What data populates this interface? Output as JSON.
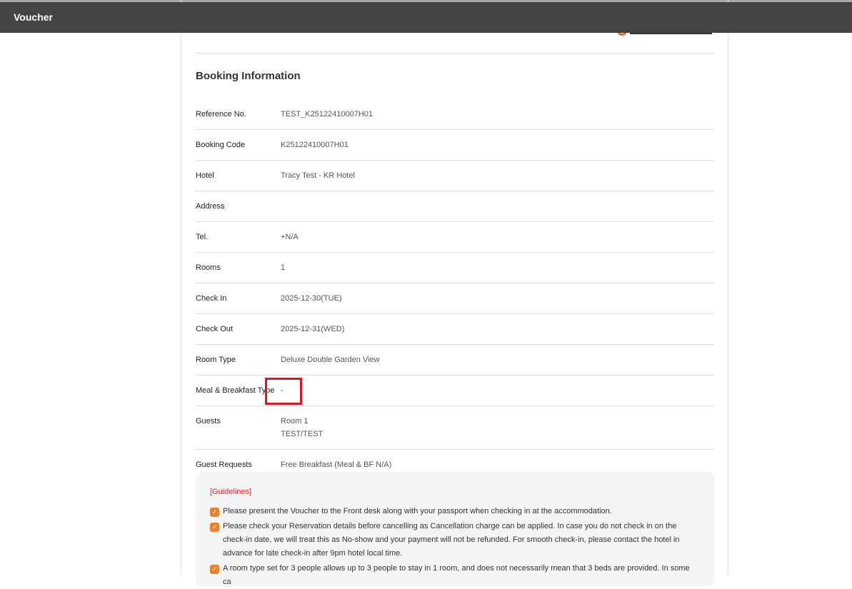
{
  "header": {
    "title": "Voucher"
  },
  "section_title": "Booking Information",
  "rows": [
    {
      "label": "Reference No.",
      "value": "TEST_K25122410007H01"
    },
    {
      "label": "Booking Code",
      "value": "K25122410007H01"
    },
    {
      "label": "Hotel",
      "value": "Tracy Test - KR Hotel"
    },
    {
      "label": "Address",
      "value": ""
    },
    {
      "label": "Tel.",
      "value": "+N/A"
    },
    {
      "label": "Rooms",
      "value": "1"
    },
    {
      "label": "Check In",
      "value": "2025-12-30(TUE)"
    },
    {
      "label": "Check Out",
      "value": "2025-12-31(WED)"
    },
    {
      "label": "Room Type",
      "value": "Deluxe Double Garden View"
    },
    {
      "label": "Meal & Breakfast Type",
      "value": "-"
    },
    {
      "label": "Guests",
      "value": "Room 1\nTEST/TEST"
    },
    {
      "label": "Guest Requests",
      "value": "Free Breakfast (Meal & BF N/A)"
    }
  ],
  "guidelines": {
    "title": "[Guidelines]",
    "items": [
      "Please present the Voucher to the Front desk along with your passport when checking in at the accommodation.",
      "Please check your Reservation details before cancelling as Cancellation charge can be applied. In case you do not check in on the check-in date, we will treat this as No-show and your payment will not be refunded. For smooth check-in, please contact the hotel in advance for late check-in after 9pm hotel local time.",
      "A room type set for 3 people allows up to 3 people to stay in 1 room, and does not necessarily mean that 3 beds are provided. In some ca"
    ]
  },
  "colors": {
    "accent": "#e8822b",
    "highlight": "#e0161e"
  }
}
